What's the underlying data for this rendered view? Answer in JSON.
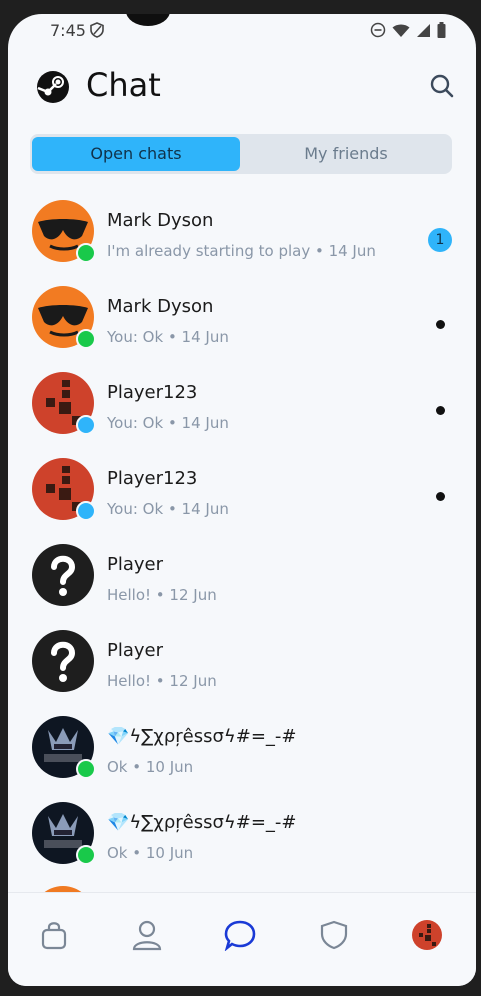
{
  "status_bar": {
    "time": "7:45"
  },
  "header": {
    "title": "Chat",
    "logo": "steam-logo",
    "search_icon": "search-icon"
  },
  "tabs": {
    "open_chats": "Open chats",
    "my_friends": "My friends",
    "active": "open_chats"
  },
  "colors": {
    "accent": "#2fb4fa",
    "online": "#19c94a",
    "away": "#2fb4fa",
    "text_muted": "#8a97a8"
  },
  "chats": [
    {
      "name": "Mark Dyson",
      "preview": "I'm already starting to play • 14 Jun",
      "status": "online",
      "avatar": "sunglasses-emoji",
      "unread": "1"
    },
    {
      "name": "Mark Dyson",
      "preview": "You: Ok • 14 Jun",
      "status": "online",
      "avatar": "sunglasses-emoji"
    },
    {
      "name": "Player123",
      "preview": "You: Ok • 14 Jun",
      "status": "away",
      "avatar": "rust-logo"
    },
    {
      "name": "Player123",
      "preview": "You: Ok • 14 Jun",
      "status": "away",
      "avatar": "rust-logo"
    },
    {
      "name": "Player",
      "preview": "Hello! • 12 Jun",
      "status": "none",
      "avatar": "question-mark"
    },
    {
      "name": "Player",
      "preview": "Hello! • 12 Jun",
      "status": "none",
      "avatar": "question-mark"
    },
    {
      "name": "💎ϟ∑χρŗêssσϟ#=_-#",
      "preview": "Ok • 10 Jun",
      "status": "online",
      "avatar": "expresso-logo"
    },
    {
      "name": "💎ϟ∑χρŗêssσϟ#=_-#",
      "preview": "Ok • 10 Jun",
      "status": "online",
      "avatar": "expresso-logo"
    }
  ],
  "bottom_nav": [
    "store-icon",
    "profile-icon",
    "chat-icon",
    "shield-icon",
    "avatar-icon"
  ],
  "bottom_nav_active": "chat-icon"
}
